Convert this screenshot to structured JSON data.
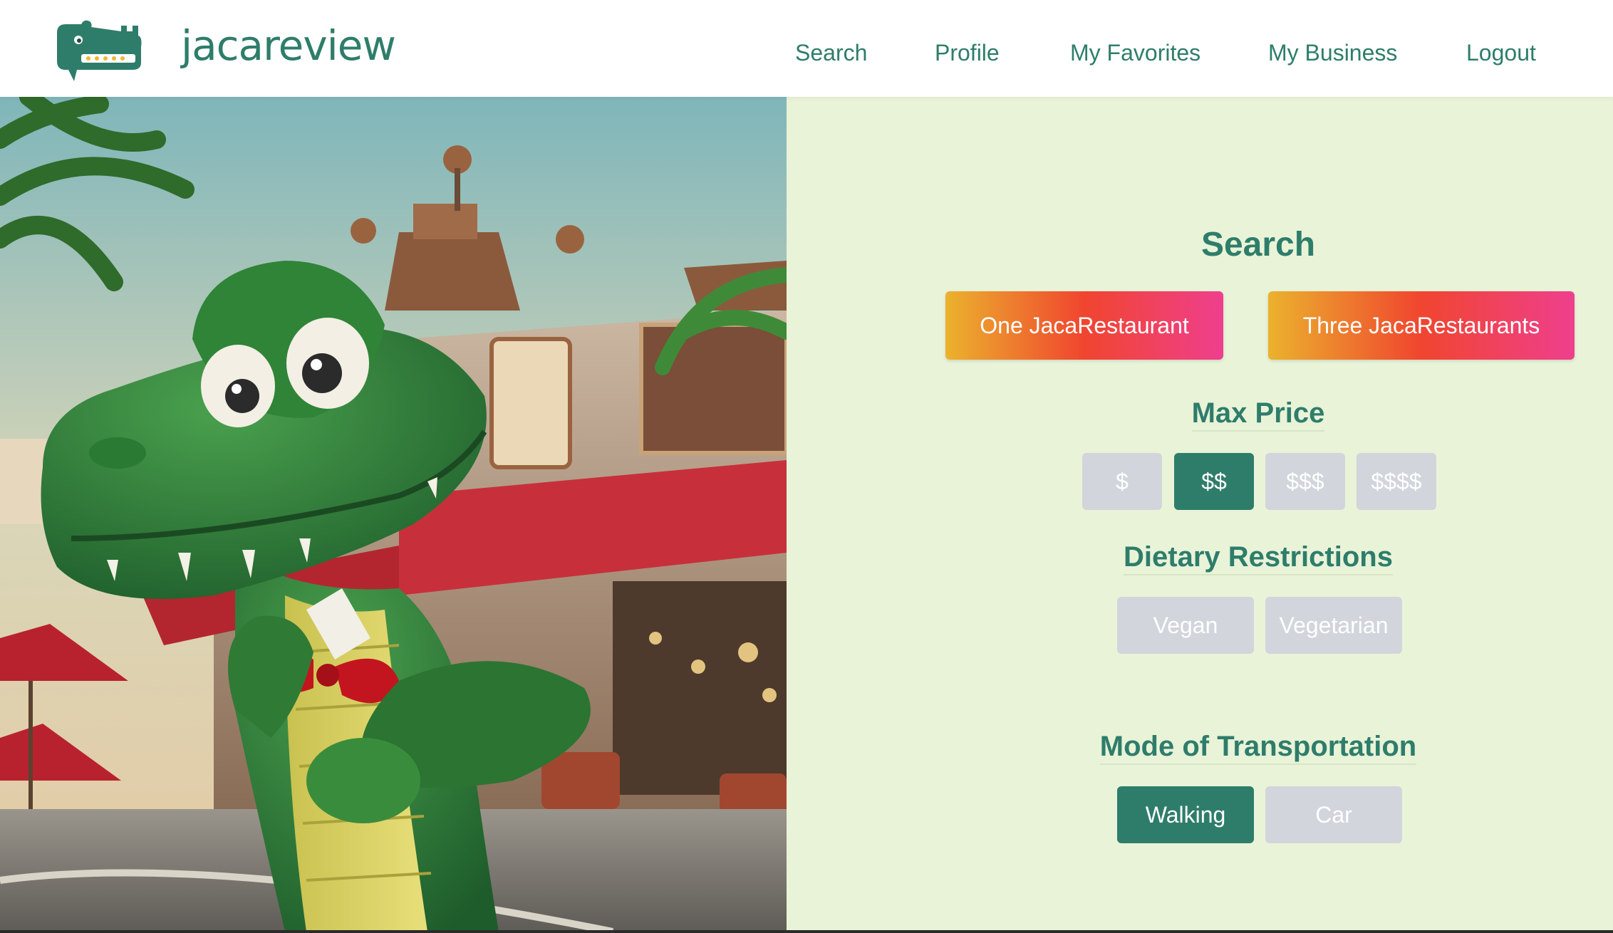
{
  "brand": {
    "name": "jacareview"
  },
  "nav": [
    {
      "label": "Search"
    },
    {
      "label": "Profile"
    },
    {
      "label": "My Favorites"
    },
    {
      "label": "My Business"
    },
    {
      "label": "Logout"
    }
  ],
  "search": {
    "title": "Search",
    "mode_buttons": [
      {
        "label": "One JacaRestaurant"
      },
      {
        "label": "Three JacaRestaurants"
      }
    ],
    "max_price": {
      "title": "Max Price",
      "options": [
        {
          "label": "$",
          "selected": false
        },
        {
          "label": "$$",
          "selected": true
        },
        {
          "label": "$$$",
          "selected": false
        },
        {
          "label": "$$$$",
          "selected": false
        }
      ]
    },
    "dietary": {
      "title": "Dietary Restrictions",
      "options": [
        {
          "label": "Vegan",
          "selected": false
        },
        {
          "label": "Vegetarian",
          "selected": false
        }
      ]
    },
    "transport": {
      "title": "Mode of Transportation",
      "options": [
        {
          "label": "Walking",
          "selected": true
        },
        {
          "label": "Car",
          "selected": false
        }
      ]
    }
  },
  "colors": {
    "primary": "#2e7d6b",
    "panel_bg": "#e9f3d8",
    "chip_inactive": "#d2d5dc",
    "gradient_start": "#ebb22d",
    "gradient_mid": "#f0452f",
    "gradient_end": "#ef3f8e"
  }
}
